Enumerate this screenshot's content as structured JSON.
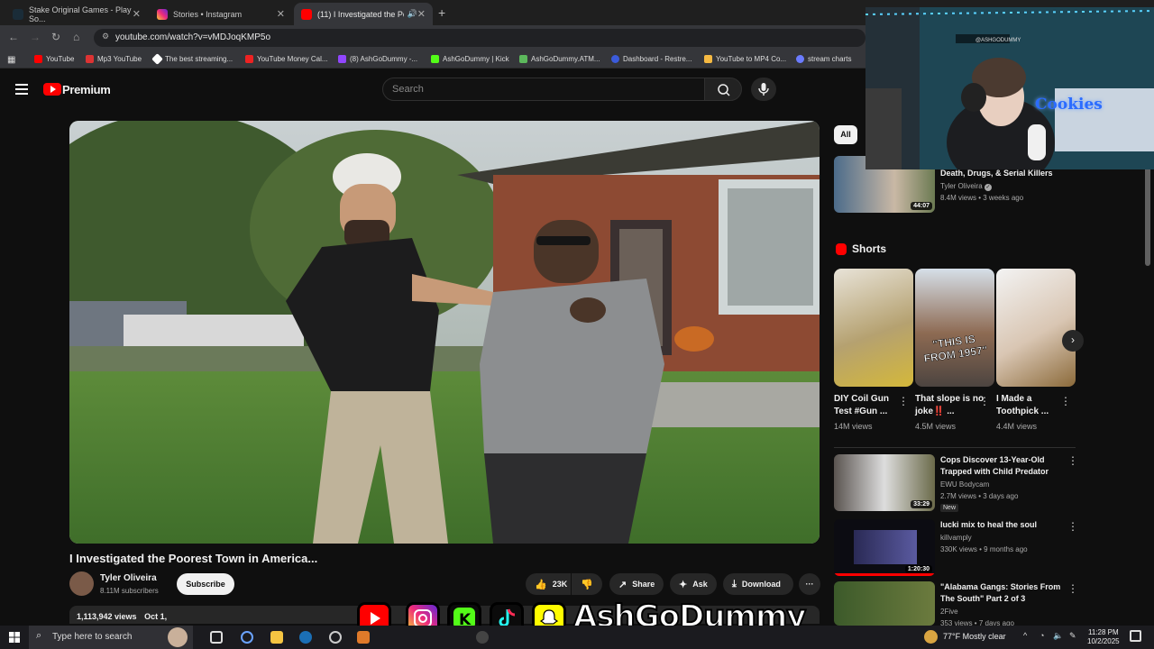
{
  "browser": {
    "tabs": [
      {
        "title": "Stake Original Games - Play So...",
        "active": false
      },
      {
        "title": "Stories • Instagram",
        "active": false
      },
      {
        "title": "(11) I Investigated the Poor...",
        "active": true
      }
    ],
    "url": "youtube.com/watch?v=vMDJoqKMP5o",
    "bookmarks": [
      "YouTube",
      "Mp3 YouTube",
      "The best streaming...",
      "YouTube Money Cal...",
      "(8) AshGoDummy -...",
      "AshGoDummy | Kick",
      "AshGoDummy.ATM...",
      "Dashboard - Restre...",
      "YouTube to MP4 Co...",
      "stream charts"
    ]
  },
  "header": {
    "brand": "Premium",
    "search_placeholder": "Search"
  },
  "video": {
    "title": "I Investigated the Poorest Town in America...",
    "channel": "Tyler Oliveira",
    "subscribers": "8.11M subscribers",
    "subscribe_label": "Subscribe",
    "likes": "23K",
    "share_label": "Share",
    "ask_label": "Ask",
    "download_label": "Download",
    "views": "1,113,942 views",
    "date": "Oct 1,"
  },
  "sidebar": {
    "chip_all": "All",
    "top_video": {
      "title": "Death, Drugs, & Serial Killers",
      "channel": "Tyler Oliveira",
      "meta": "8.4M views • 3 weeks ago",
      "duration": "44:07"
    },
    "shorts_label": "Shorts",
    "shorts": [
      {
        "title": "DIY Coil Gun Test #Gun ...",
        "views": "14M views"
      },
      {
        "title": "That slope is no joke‼️ ...",
        "views": "4.5M views"
      },
      {
        "title": "I Made a Toothpick ...",
        "views": "4.4M views"
      }
    ],
    "short2_overlay": "\"THIS IS FROM 1957\"",
    "videos": [
      {
        "title": "Cops Discover 13-Year-Old Trapped with Child Predator",
        "channel": "EWU Bodycam",
        "meta": "2.7M views • 3 days ago",
        "badge": "New",
        "duration": "33:29"
      },
      {
        "title": "lucki mix to heal the soul",
        "channel": "killvamply",
        "meta": "330K views • 9 months ago",
        "duration": "1:20:30"
      },
      {
        "title": "\"Alabama Gangs: Stories From The South\" Part 2 of 3",
        "channel": "2Five",
        "meta": "353 views • 7 days ago"
      }
    ]
  },
  "overlay": {
    "streamer_name": "AshGoDummy",
    "cam_sign": "@ASHGODUMMY",
    "cam_neon": "Cookies"
  },
  "taskbar": {
    "search_placeholder": "Type here to search",
    "weather": "77°F  Mostly clear",
    "time": "11:28 PM",
    "date": "10/2/2025"
  },
  "colors": {
    "accent": "#ff0000",
    "bg": "#0f0f0f",
    "kick": "#53fc18"
  }
}
